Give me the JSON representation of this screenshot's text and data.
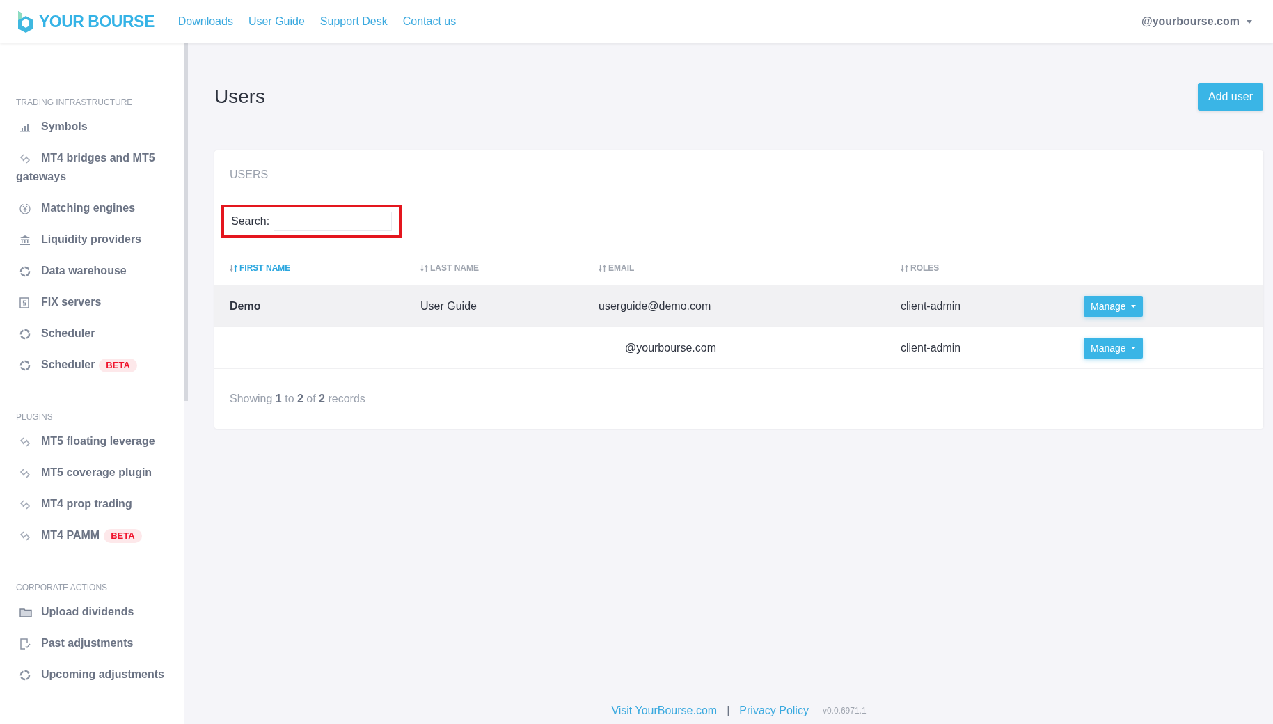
{
  "header": {
    "brand": "YOUR BOURSE",
    "nav": [
      "Downloads",
      "User Guide",
      "Support Desk",
      "Contact us"
    ],
    "account": "@yourbourse.com"
  },
  "sidebar": {
    "sections": [
      {
        "title": "TRADING INFRASTRUCTURE",
        "items": [
          {
            "label": "Symbols",
            "kind": "chart"
          },
          {
            "label": "MT4 bridges and MT5 gateways",
            "kind": "link"
          },
          {
            "label": "Matching engines",
            "kind": "yen"
          },
          {
            "label": "Liquidity providers",
            "kind": "bank"
          },
          {
            "label": "Data warehouse",
            "kind": "ring"
          },
          {
            "label": "FIX servers",
            "kind": "server"
          },
          {
            "label": "Scheduler",
            "kind": "ring"
          },
          {
            "label": "Scheduler",
            "kind": "ring",
            "badge": "BETA"
          }
        ]
      },
      {
        "title": "PLUGINS",
        "items": [
          {
            "label": "MT5 floating leverage",
            "kind": "link"
          },
          {
            "label": "MT5 coverage plugin",
            "kind": "link"
          },
          {
            "label": "MT4 prop trading",
            "kind": "link"
          },
          {
            "label": "MT4 PAMM",
            "kind": "link",
            "badge": "BETA"
          }
        ]
      },
      {
        "title": "CORPORATE ACTIONS",
        "items": [
          {
            "label": "Upload dividends",
            "kind": "folder"
          },
          {
            "label": "Past adjustments",
            "kind": "check"
          },
          {
            "label": "Upcoming adjustments",
            "kind": "ring"
          }
        ]
      }
    ]
  },
  "page": {
    "title": "Users",
    "add_button": "Add user"
  },
  "card": {
    "title": "USERS",
    "search": {
      "label": "Search:",
      "highlighted": true
    },
    "table": {
      "columns": [
        {
          "label": "FIRST NAME",
          "sorted": true
        },
        {
          "label": "LAST NAME",
          "sorted": false
        },
        {
          "label": "EMAIL",
          "sorted": false
        },
        {
          "label": "ROLES",
          "sorted": false
        }
      ],
      "rows": [
        {
          "first_name": "Demo",
          "last_name": "User Guide",
          "email": "userguide@demo.com",
          "roles": "client-admin",
          "action": "Manage",
          "highlighted": true
        },
        {
          "email": "@yourbourse.com",
          "roles": "client-admin",
          "action": "Manage",
          "highlighted": false
        }
      ]
    },
    "summary": "Showing **1** to **2** of **2** records"
  },
  "footer": {
    "links": [
      "Visit YourBourse.com",
      "Privacy Policy"
    ],
    "separator": "|",
    "version": "v0.0.6971.1"
  }
}
